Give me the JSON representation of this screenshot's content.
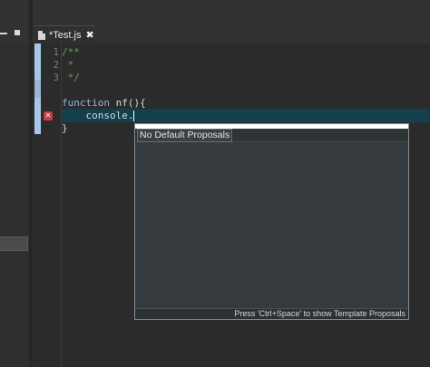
{
  "editor": {
    "tab": {
      "label": "*Test.js",
      "close_glyph": "✖",
      "icon": "file-icon"
    },
    "line_numbers": [
      "1",
      "2",
      "3"
    ],
    "code": {
      "line1": "/**",
      "line2": " *",
      "line3": " */",
      "func_keyword": "function",
      "func_rest": " nf(){",
      "line6_text": "    console.",
      "line7": "}"
    },
    "markers": {
      "error_icon": "error-marker-icon"
    }
  },
  "content_assist": {
    "title": "No Default Proposals",
    "proposals": [],
    "footer_hint": "Press 'Ctrl+Space' to show Template Proposals"
  },
  "colors": {
    "editor_bg": "#2b2b2b",
    "current_line": "#13404d",
    "comment": "#6a9a5a",
    "keyword": "#8fb2e6",
    "error": "#c93d3d",
    "ruler": "#a7c7e8"
  }
}
